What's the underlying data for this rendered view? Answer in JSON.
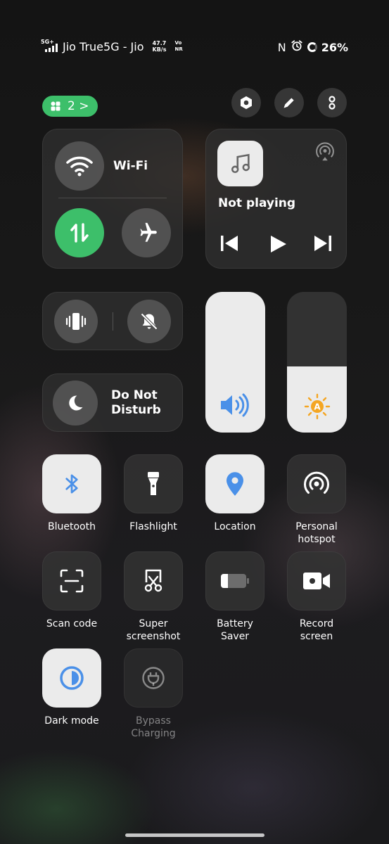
{
  "status_bar": {
    "network_type": "5G+",
    "carrier": "Jio True5G - Jio",
    "speed_value": "47.7",
    "speed_unit": "KB/s",
    "volte_top": "Vo",
    "volte_bottom": "NR",
    "nfc_symbol": "N",
    "battery": "26%",
    "battery_level": 0.26
  },
  "top_bar": {
    "page_indicator": "2 >"
  },
  "connectivity": {
    "wifi_label": "Wi-Fi",
    "mobile_data_on": true,
    "airplane_on": false
  },
  "media": {
    "status": "Not playing"
  },
  "sound_modes": {
    "vibrate_on": true,
    "mute_on": false
  },
  "dnd": {
    "label": "Do Not Disturb"
  },
  "sliders": {
    "volume_level": 1.0,
    "brightness_level": 0.47
  },
  "colors": {
    "accent_green": "#3dbf6a",
    "accent_blue": "#4a90e8",
    "brightness_icon": "#f4a623"
  },
  "tiles": [
    {
      "label": "Bluetooth",
      "icon": "bluetooth-icon",
      "on": true
    },
    {
      "label": "Flashlight",
      "icon": "flashlight-icon",
      "on": false
    },
    {
      "label": "Location",
      "icon": "location-icon",
      "on": true
    },
    {
      "label": "Personal\nhotspot",
      "icon": "hotspot-icon",
      "on": false
    },
    {
      "label": "Scan code",
      "icon": "scan-code-icon",
      "on": false
    },
    {
      "label": "Super\nscreenshot",
      "icon": "screenshot-icon",
      "on": false
    },
    {
      "label": "Battery\nSaver",
      "icon": "battery-saver-icon",
      "on": false
    },
    {
      "label": "Record\nscreen",
      "icon": "record-screen-icon",
      "on": false
    },
    {
      "label": "Dark mode",
      "icon": "dark-mode-icon",
      "on": true
    },
    {
      "label": "Bypass\nCharging",
      "icon": "bypass-charging-icon",
      "on": false,
      "disabled": true
    }
  ]
}
